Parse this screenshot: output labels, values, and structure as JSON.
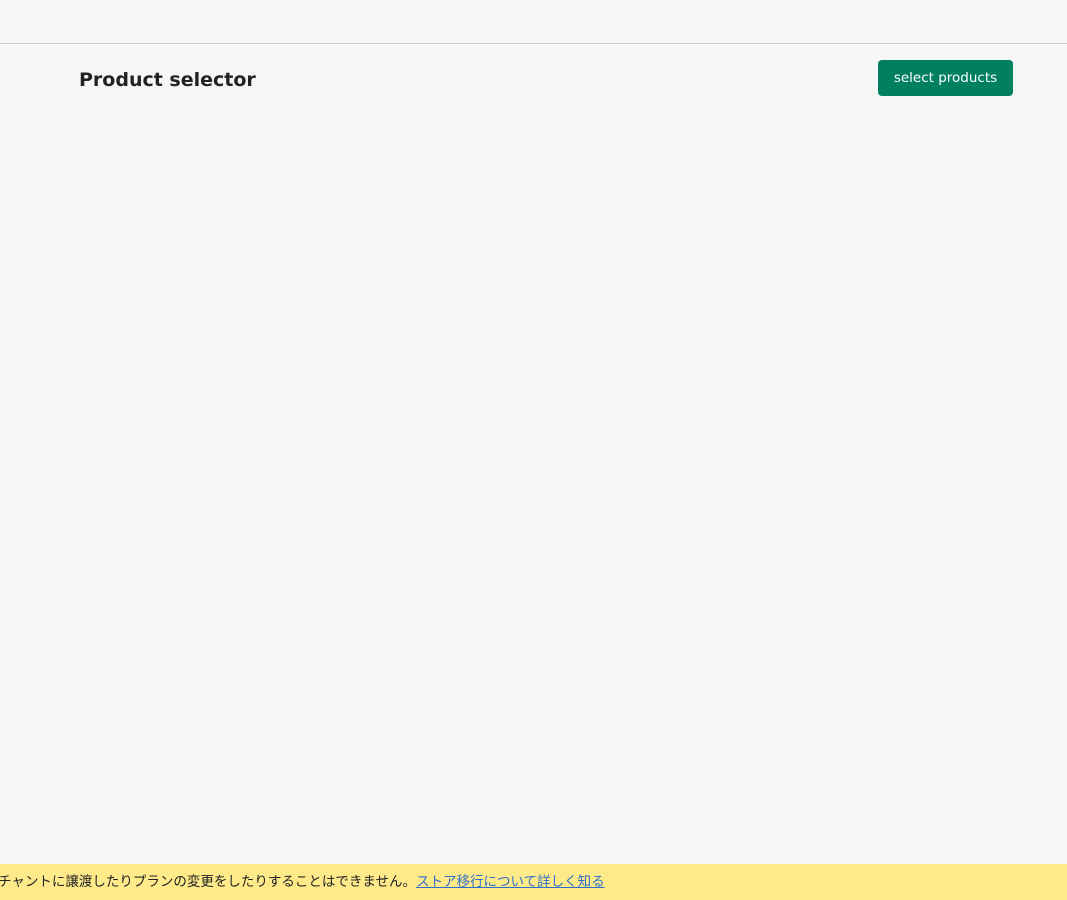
{
  "header": {
    "title": "Product selector",
    "primary_action_label": "select products"
  },
  "banner": {
    "message": "チャントに譲渡したりプランの変更をしたりすることはできません。",
    "link_label": "ストア移行について詳しく知る"
  },
  "colors": {
    "background": "#f6f6f6",
    "primary_button": "#008060",
    "banner_background": "#ffea8a",
    "link": "#2c6ecb"
  }
}
